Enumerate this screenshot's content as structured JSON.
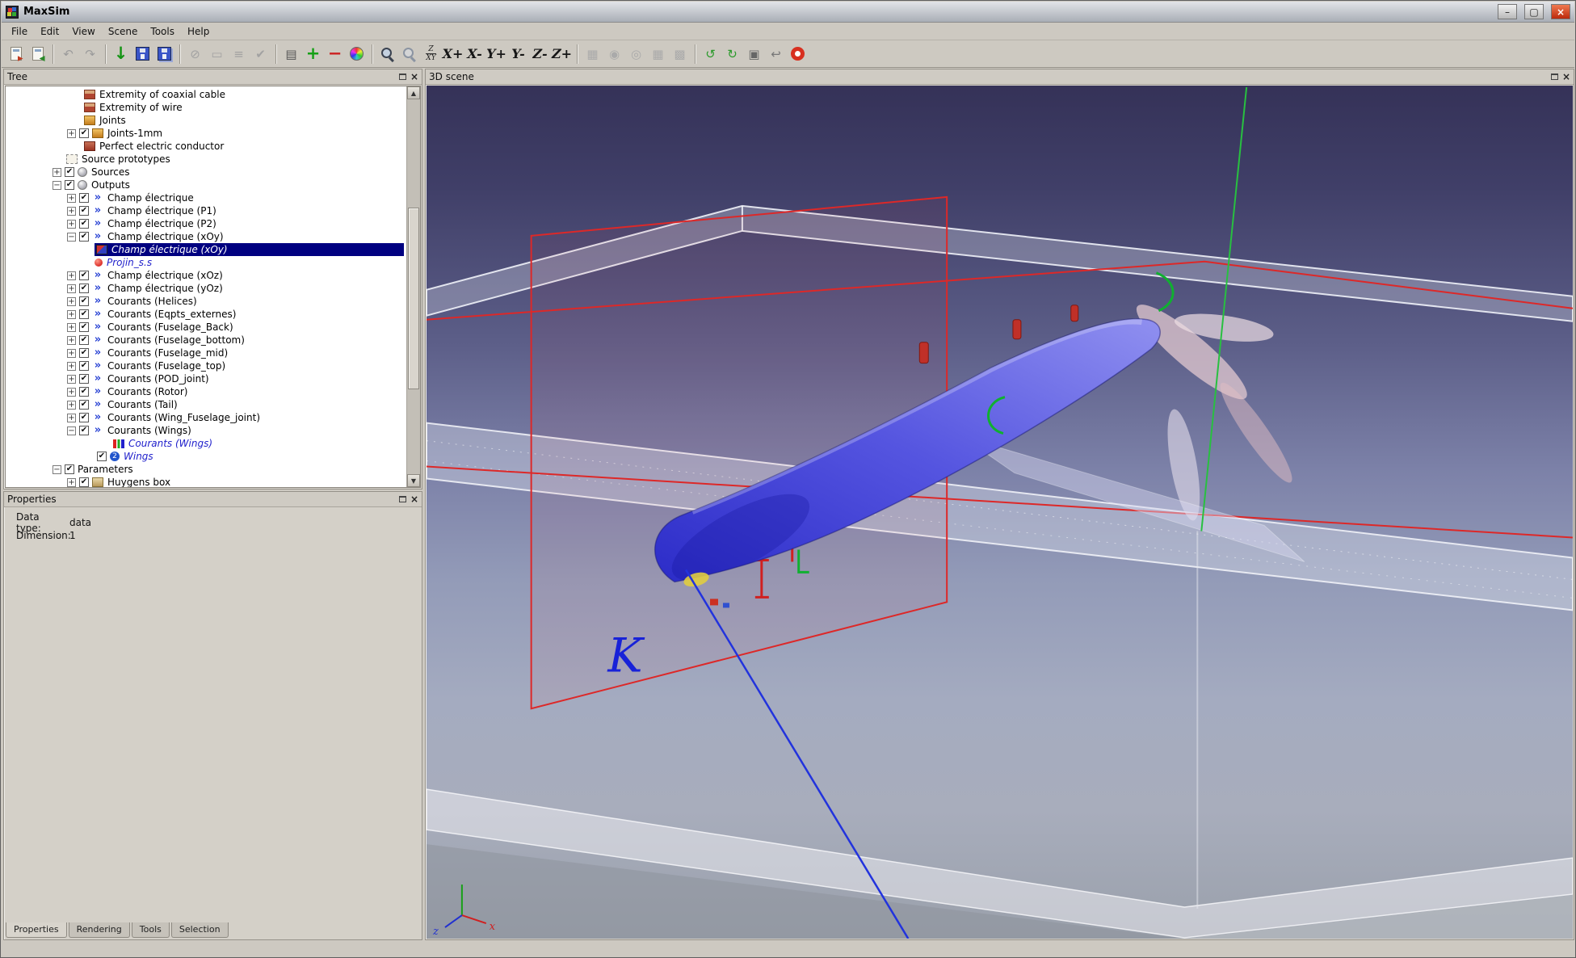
{
  "window": {
    "title": "MaxSim",
    "buttons": {
      "minimize": "–",
      "maximize": "▢",
      "close": "×"
    }
  },
  "ui": {
    "close_glyph": "×",
    "check_glyph": "✔",
    "scroll_up": "▲",
    "scroll_down": "▼"
  },
  "menu": {
    "items": [
      "File",
      "Edit",
      "View",
      "Scene",
      "Tools",
      "Help"
    ]
  },
  "toolbar": {
    "buttons": [
      {
        "kind": "doc",
        "name": "import-model-button"
      },
      {
        "kind": "doc2",
        "name": "export-model-button"
      },
      {
        "kind": "sep"
      },
      {
        "kind": "glyph",
        "name": "undo-button",
        "glyph": "↶",
        "color": "#9b9b9b",
        "disabled": true
      },
      {
        "kind": "glyph",
        "name": "redo-button",
        "glyph": "↷",
        "color": "#9b9b9b",
        "disabled": true
      },
      {
        "kind": "sep"
      },
      {
        "kind": "glyph",
        "name": "import-results-button",
        "glyph": "↓",
        "color": "#149414",
        "big": true
      },
      {
        "kind": "floppy",
        "name": "save-button"
      },
      {
        "kind": "floppy2",
        "name": "save-as-button"
      },
      {
        "kind": "sep"
      },
      {
        "kind": "glyph",
        "name": "cancel-button",
        "glyph": "⊘",
        "color": "#a2a2a2",
        "disabled": true
      },
      {
        "kind": "glyph",
        "name": "stop-button",
        "glyph": "▭",
        "color": "#a2a2a2",
        "disabled": true
      },
      {
        "kind": "glyph",
        "name": "equalize-button",
        "glyph": "≡",
        "color": "#a2a2a2",
        "disabled": true
      },
      {
        "kind": "glyph",
        "name": "validate-button",
        "glyph": "✔",
        "color": "#a2a2a2",
        "disabled": true
      },
      {
        "kind": "sep"
      },
      {
        "kind": "glyph",
        "name": "snapshot-button",
        "glyph": "▤",
        "color": "#555555"
      },
      {
        "kind": "glyph",
        "name": "add-item-button",
        "glyph": "+",
        "color": "#16a016",
        "big": true
      },
      {
        "kind": "glyph",
        "name": "remove-item-button",
        "glyph": "−",
        "color": "#cc2222",
        "big": true
      },
      {
        "kind": "colorwheel",
        "name": "color-palette-button"
      },
      {
        "kind": "sep"
      },
      {
        "kind": "magnifier",
        "name": "zoom-button"
      },
      {
        "kind": "magnifier2",
        "name": "zoom-region-button"
      },
      {
        "kind": "fraction",
        "name": "scale-axes-button",
        "top": "Z",
        "bottom": "XY"
      },
      {
        "kind": "text",
        "name": "view-x-plus-button",
        "label": "X+"
      },
      {
        "kind": "text",
        "name": "view-x-minus-button",
        "label": "X-"
      },
      {
        "kind": "text",
        "name": "view-y-plus-button",
        "label": "Y+"
      },
      {
        "kind": "text",
        "name": "view-y-minus-button",
        "label": "Y-"
      },
      {
        "kind": "text",
        "name": "view-z-minus-button",
        "label": "Z-"
      },
      {
        "kind": "text",
        "name": "view-z-plus-button",
        "label": "Z+"
      },
      {
        "kind": "sep"
      },
      {
        "kind": "glyph",
        "name": "mesh-view-button",
        "glyph": "▦",
        "color": "#aaaaaa",
        "disabled": true
      },
      {
        "kind": "glyph",
        "name": "sphere-view-button",
        "glyph": "◉",
        "color": "#aaaaaa",
        "disabled": true
      },
      {
        "kind": "glyph",
        "name": "globe-view-button",
        "glyph": "◎",
        "color": "#aaaaaa",
        "disabled": true
      },
      {
        "kind": "glyph",
        "name": "table-view-button",
        "glyph": "▦",
        "color": "#aaaaaa",
        "disabled": true
      },
      {
        "kind": "glyph",
        "name": "grid-view-button",
        "glyph": "▩",
        "color": "#aaaaaa",
        "disabled": true
      },
      {
        "kind": "sep"
      },
      {
        "kind": "glyph",
        "name": "rotate-left-button",
        "glyph": "↺",
        "color": "#2a9a2a"
      },
      {
        "kind": "glyph",
        "name": "rotate-right-button",
        "glyph": "↻",
        "color": "#2a9a2a"
      },
      {
        "kind": "glyph",
        "name": "screenshot-button",
        "glyph": "▣",
        "color": "#666666"
      },
      {
        "kind": "glyph",
        "name": "back-view-button",
        "glyph": "↩",
        "color": "#777777"
      },
      {
        "kind": "lifering",
        "name": "help-button"
      }
    ]
  },
  "panels": {
    "tree": {
      "title": "Tree",
      "items": [
        {
          "pad": 97,
          "icon": "card",
          "label": "Extremity of coaxial cable"
        },
        {
          "pad": 97,
          "icon": "card",
          "label": "Extremity of wire"
        },
        {
          "pad": 97,
          "icon": "joint",
          "label": "Joints"
        },
        {
          "pad": 76,
          "ex": "+",
          "cb": true,
          "icon": "joint",
          "label": "Joints-1mm"
        },
        {
          "pad": 97,
          "icon": "conductor",
          "label": "Perfect electric conductor"
        },
        {
          "pad": 75,
          "icon": "proto",
          "label": "Source prototypes"
        },
        {
          "pad": 58,
          "ex": "+",
          "cb": true,
          "icon": "sphere",
          "label": "Sources"
        },
        {
          "pad": 58,
          "ex": "-",
          "cb": true,
          "icon": "sphere",
          "label": "Outputs"
        },
        {
          "pad": 76,
          "ex": "+",
          "cb": true,
          "icon": "flow",
          "label": "Champ électrique"
        },
        {
          "pad": 76,
          "ex": "+",
          "cb": true,
          "icon": "flow",
          "label": "Champ électrique (P1)"
        },
        {
          "pad": 76,
          "ex": "+",
          "cb": true,
          "icon": "flow",
          "label": "Champ électrique (P2)"
        },
        {
          "pad": 76,
          "ex": "-",
          "cb": true,
          "icon": "flow",
          "label": "Champ électrique (xOy)"
        },
        {
          "pad": 110,
          "icon": "cube3d",
          "label": "Champ électrique (xOy)",
          "style": "selected"
        },
        {
          "pad": 110,
          "icon": "dotred",
          "label": "Projin_s.s",
          "style": "blue"
        },
        {
          "pad": 76,
          "ex": "+",
          "cb": true,
          "icon": "flow",
          "label": "Champ électrique (xOz)"
        },
        {
          "pad": 76,
          "ex": "+",
          "cb": true,
          "icon": "flow",
          "label": "Champ électrique (yOz)"
        },
        {
          "pad": 76,
          "ex": "+",
          "cb": true,
          "icon": "flow",
          "label": "Courants (Helices)"
        },
        {
          "pad": 76,
          "ex": "+",
          "cb": true,
          "icon": "flow",
          "label": "Courants (Eqpts_externes)"
        },
        {
          "pad": 76,
          "ex": "+",
          "cb": true,
          "icon": "flow",
          "label": "Courants (Fuselage_Back)"
        },
        {
          "pad": 76,
          "ex": "+",
          "cb": true,
          "icon": "flow",
          "label": "Courants (Fuselage_bottom)"
        },
        {
          "pad": 76,
          "ex": "+",
          "cb": true,
          "icon": "flow",
          "label": "Courants (Fuselage_mid)"
        },
        {
          "pad": 76,
          "ex": "+",
          "cb": true,
          "icon": "flow",
          "label": "Courants (Fuselage_top)"
        },
        {
          "pad": 76,
          "ex": "+",
          "cb": true,
          "icon": "flow",
          "label": "Courants (POD_joint)"
        },
        {
          "pad": 76,
          "ex": "+",
          "cb": true,
          "icon": "flow",
          "label": "Courants (Rotor)"
        },
        {
          "pad": 76,
          "ex": "+",
          "cb": true,
          "icon": "flow",
          "label": "Courants (Tail)"
        },
        {
          "pad": 76,
          "ex": "+",
          "cb": true,
          "icon": "flow",
          "label": "Courants (Wing_Fuselage_joint)"
        },
        {
          "pad": 76,
          "ex": "-",
          "cb": true,
          "icon": "flow",
          "label": "Courants (Wings)"
        },
        {
          "pad": 133,
          "icon": "chart",
          "label": "Courants (Wings)",
          "style": "blue"
        },
        {
          "pad": 113,
          "cb": true,
          "icon": "circle2",
          "label": "Wings",
          "style": "blue"
        },
        {
          "pad": 58,
          "ex": "-",
          "cb": true,
          "label": "Parameters"
        },
        {
          "pad": 76,
          "ex": "+",
          "cb": true,
          "icon": "boxtan",
          "label": "Huygens box"
        }
      ]
    },
    "properties": {
      "title": "Properties",
      "fields": [
        {
          "label": "Data type:",
          "value": "data"
        },
        {
          "label": "Dimension:",
          "value": "1"
        }
      ],
      "tabs": [
        {
          "label": "Properties",
          "active": true
        },
        {
          "label": "Rendering"
        },
        {
          "label": "Tools"
        },
        {
          "label": "Selection"
        }
      ]
    },
    "scene": {
      "title": "3D scene",
      "k_label": "K",
      "axis_x": "x",
      "axis_z": "z"
    }
  }
}
